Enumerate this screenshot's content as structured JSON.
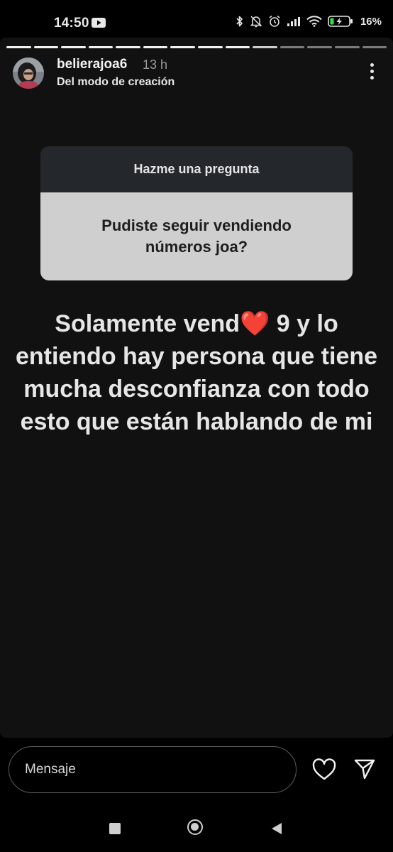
{
  "status_bar": {
    "time": "14:50",
    "battery": "16%",
    "icons": [
      "youtube-icon",
      "bluetooth-icon",
      "notifications-off-icon",
      "alarm-icon",
      "signal-icon",
      "wifi-icon",
      "battery-charging-icon"
    ]
  },
  "story": {
    "progress_segments_total": 14,
    "progress_segments_complete": 9,
    "username": "belierajoa6",
    "time_ago": "13 h",
    "subtitle": "Del modo de creación",
    "question_sticker": {
      "header": "Hazme una pregunta",
      "question": "Pudiste seguir vendiendo números joa?"
    },
    "answer": {
      "before_heart": "Solamente vend",
      "heart": "❤️",
      "after_heart": " 9 y lo entiendo hay persona que tiene mucha desconfianza con todo esto que están hablando de mi"
    }
  },
  "reply_bar": {
    "placeholder": "Mensaje"
  },
  "colors": {
    "story_background": "#111111",
    "sticker_header": "#24272b",
    "sticker_body": "#cfcfcf",
    "heart": "#e2262f"
  }
}
